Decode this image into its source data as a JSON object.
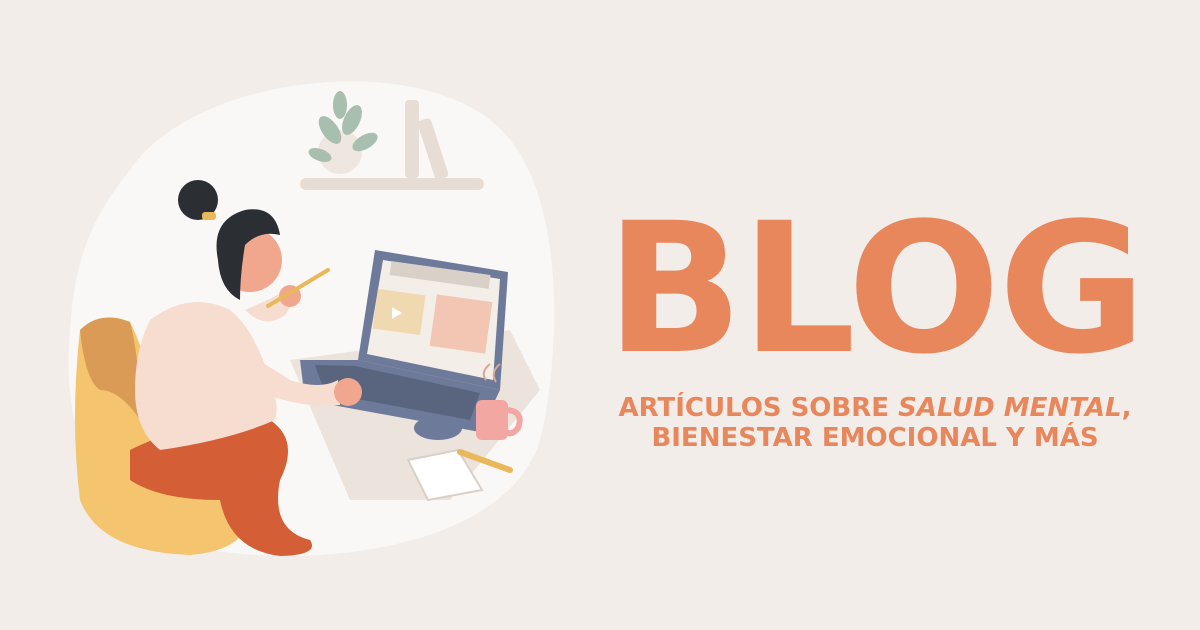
{
  "title": "BLOG",
  "subtitle": {
    "line1_prefix": "ARTÍCULOS SOBRE ",
    "line1_emphasis": "SALUD MENTAL",
    "line1_suffix": ",",
    "line2": "BIENESTAR EMOCIONAL Y MÁS"
  },
  "colors": {
    "background": "#f2ede9",
    "accent": "#e8865c"
  },
  "illustration": {
    "description_icon": "woman-laptop-illustration"
  }
}
